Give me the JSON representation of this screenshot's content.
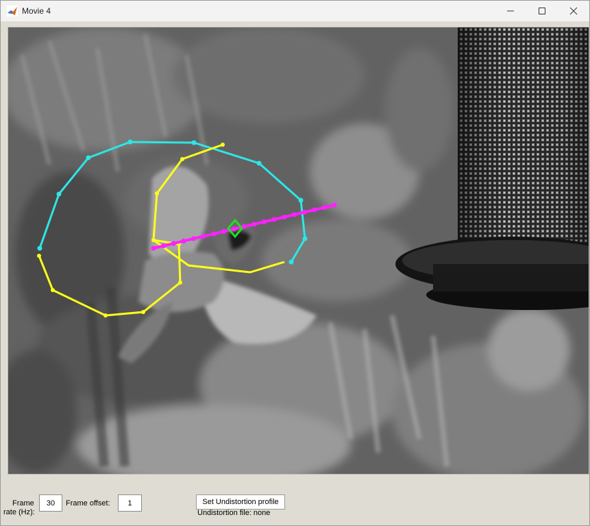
{
  "window": {
    "title": "Movie 4",
    "controls": {
      "minimize_icon": "minimize-icon",
      "maximize_icon": "maximize-icon",
      "close_icon": "close-icon"
    }
  },
  "image": {
    "description_icon": "video-frame",
    "track_colors": {
      "cyan": "#2ee6e6",
      "yellow": "#ffff1a",
      "magenta": "#ff20ff",
      "green": "#22dd22"
    }
  },
  "controls": {
    "frame_rate_label_line1": "Frame",
    "frame_rate_label_line2": "rate (Hz):",
    "frame_rate_value": "30",
    "frame_offset_label": "Frame offset:",
    "frame_offset_value": "1",
    "undistortion_button": "Set Undistortion profile",
    "undistortion_status": "Undistortion file: none"
  }
}
